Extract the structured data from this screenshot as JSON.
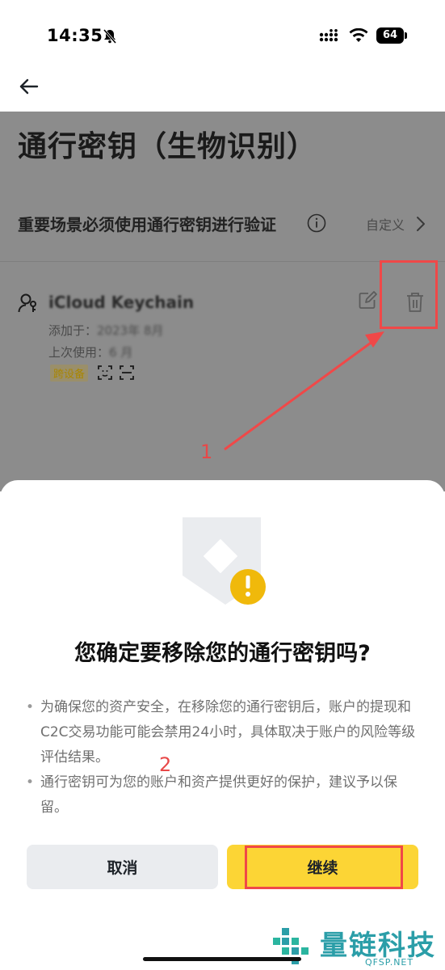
{
  "status_bar": {
    "time": "14:35",
    "battery": "64"
  },
  "page": {
    "title": "通行密钥（生物识别）",
    "verify_text": "重要场景必须使用通行密钥进行验证",
    "custom_link": "自定义"
  },
  "passkey": {
    "name": "iCloud Keychain",
    "added_label": "添加于：",
    "added_value": "2023年 8月",
    "last_used_label": "上次使用：",
    "last_used_value": "6 月",
    "tag": "跨设备"
  },
  "annotations": {
    "label_1": "1",
    "label_2": "2"
  },
  "dialog": {
    "title": "您确定要移除您的通行密钥吗?",
    "bullets": [
      "为确保您的资产安全，在移除您的通行密钥后，账户的提现和C2C交易功能可能会禁用24小时，具体取决于账户的风险等级评估结果。",
      "通行密钥可为您的账户和资产提供更好的保护，建议予以保留。"
    ],
    "cancel_label": "取消",
    "continue_label": "继续"
  },
  "watermark": {
    "text": "量链科技",
    "sub": "QFSP.NET"
  },
  "colors": {
    "accent": "#fcd535",
    "annotation": "#f04848",
    "overlay": "#8c8c8c",
    "warning": "#f0b90b"
  }
}
